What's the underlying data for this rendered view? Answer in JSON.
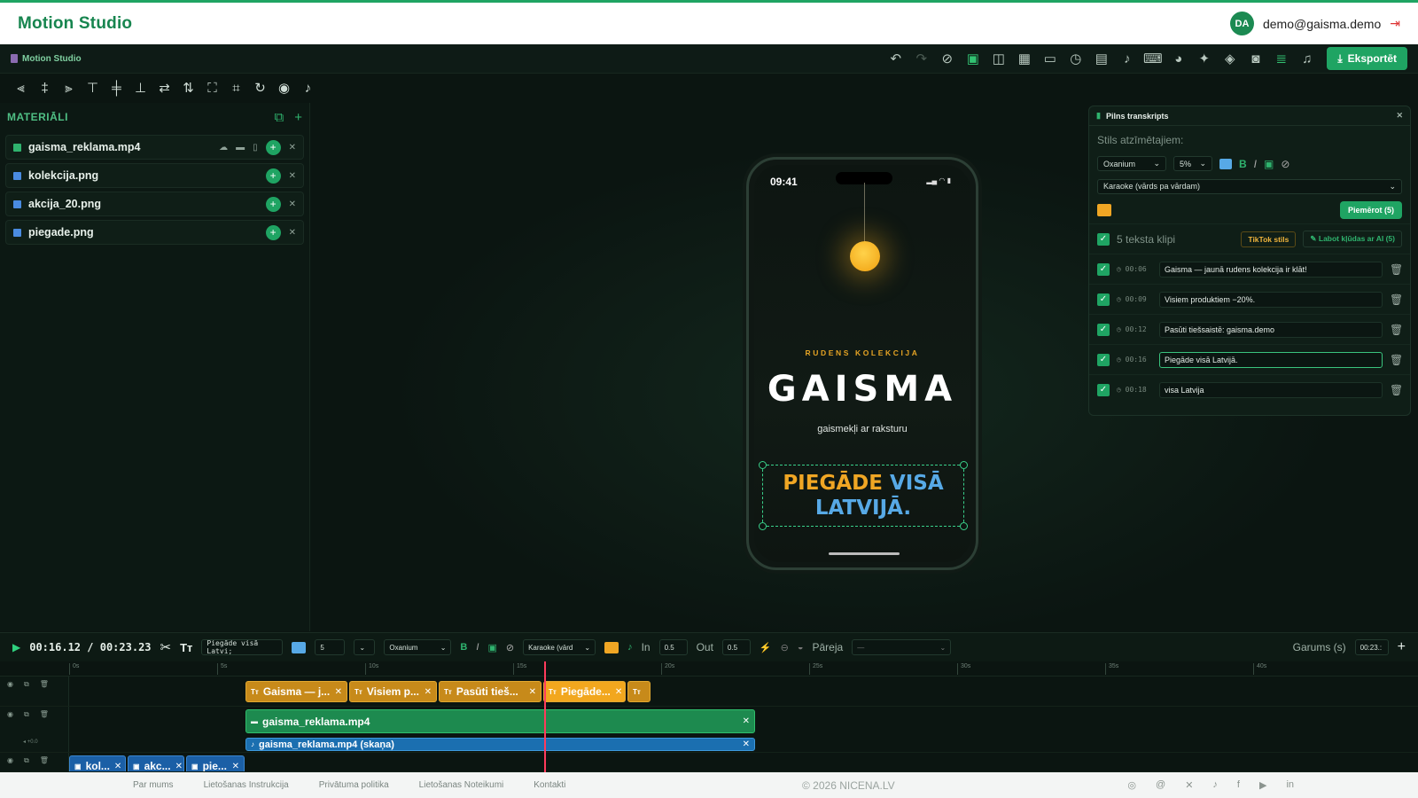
{
  "site": {
    "brand": "Motion Studio",
    "user_initials": "DA",
    "user_email": "demo@gaisma.demo",
    "logout_icon": "logout-icon"
  },
  "app": {
    "name": "Motion Studio",
    "export_label": "Eksportēt"
  },
  "assets": {
    "title": "MATERIĀLI",
    "items": [
      {
        "name": "gaisma_reklama.mp4",
        "type": "video"
      },
      {
        "name": "kolekcija.png",
        "type": "image"
      },
      {
        "name": "akcija_20.png",
        "type": "image"
      },
      {
        "name": "piegade.png",
        "type": "image"
      }
    ]
  },
  "preview": {
    "time": "09:41",
    "kicker": "RUDENS KOLEKCIJA",
    "title": "GAISMA",
    "subtitle": "gaismekļi ar raksturu",
    "caption_highlight": "PIEGĀDE",
    "caption_rest_1": "VISĀ",
    "caption_rest_2": "LATVIJĀ."
  },
  "transcript": {
    "title": "Pilns transkripts",
    "style_label": "Stils atzīmētajiem:",
    "font": "Oxanium",
    "size": "5%",
    "mode": "Karaoke (vārds pa vārdam)",
    "apply_label": "Piemērot (5)",
    "clip_count": "5 teksta klipi",
    "tiktok_label": "TikTok stils",
    "ai_label": "Labot kļūdas ar AI (5)",
    "clips": [
      {
        "time": "00:06",
        "text": "Gaisma — jaunā rudens kolekcija ir klāt!"
      },
      {
        "time": "00:09",
        "text": "Visiem produktiem −20%."
      },
      {
        "time": "00:12",
        "text": "Pasūti tiešsaistē: gaisma.demo"
      },
      {
        "time": "00:16",
        "text": "Piegāde visā Latvijā."
      },
      {
        "time": "00:18",
        "text": "visa Latvija"
      }
    ]
  },
  "timeline": {
    "current": "00:16.12",
    "separator": "/",
    "total": "00:23.23",
    "text_value": "Piegāde visā Latvi;",
    "size_value": "5",
    "font": "Oxanium",
    "mode": "Karaoke (vārd",
    "in_label": "In",
    "in_value": "0.5",
    "out_label": "Out",
    "out_value": "0.5",
    "transition_label": "Pāreja",
    "transition_value": "—",
    "duration_label": "Garums (s)",
    "duration_value": "00:23.:",
    "ticks": [
      "0s",
      "5s",
      "10s",
      "15s",
      "20s",
      "25s",
      "30s",
      "35s",
      "40s"
    ],
    "text_clips": [
      "Gaisma — j...",
      "Visiem p...",
      "Pasūti tieš...",
      "Piegāde...",
      ""
    ],
    "video_clip": "gaisma_reklama.mp4",
    "audio_clip": "gaisma_reklama.mp4 (skaņa)",
    "image_clips": [
      "kol...",
      "akc...",
      "pie..."
    ],
    "volume_label": "+0.0"
  },
  "footer": {
    "links": [
      "Par mums",
      "Lietošanas Instrukcija",
      "Privātuma politika",
      "Lietošanas Noteikumi",
      "Kontakti"
    ],
    "copyright": "© 2026 NICENA.LV"
  },
  "colors": {
    "accent": "#1fa463",
    "caption_highlight": "#f0a624",
    "caption_text": "#57a9e6",
    "playhead": "#ff3b5c"
  }
}
